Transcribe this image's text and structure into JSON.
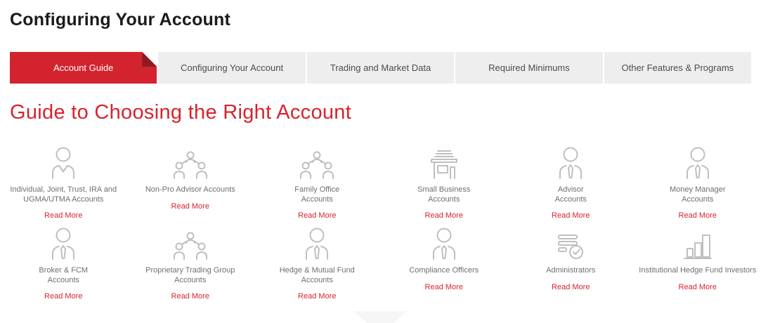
{
  "header": {
    "title": "Configuring Your Account"
  },
  "tabs": [
    {
      "label": "Account Guide",
      "active": true
    },
    {
      "label": "Configuring Your Account",
      "active": false
    },
    {
      "label": "Trading and Market Data",
      "active": false
    },
    {
      "label": "Required Minimums",
      "active": false
    },
    {
      "label": "Other Features & Programs",
      "active": false
    }
  ],
  "section": {
    "heading": "Guide to Choosing the Right Account",
    "read_more_label": "Read More"
  },
  "cards": [
    {
      "line1": "Individual, Joint, Trust, IRA and",
      "line2": "UGMA/UTMA Accounts",
      "icon": "person-icon"
    },
    {
      "line1": "Non-Pro Advisor Accounts",
      "line2": "",
      "icon": "people-group-icon"
    },
    {
      "line1": "Family Office",
      "line2": "Accounts",
      "icon": "people-group-icon"
    },
    {
      "line1": "Small Business",
      "line2": "Accounts",
      "icon": "storefront-icon"
    },
    {
      "line1": "Advisor",
      "line2": "Accounts",
      "icon": "person-tie-icon"
    },
    {
      "line1": "Money Manager",
      "line2": "Accounts",
      "icon": "person-tie-icon"
    },
    {
      "line1": "Broker & FCM",
      "line2": "Accounts",
      "icon": "person-tie-icon"
    },
    {
      "line1": "Proprietary Trading Group",
      "line2": "Accounts",
      "icon": "people-group-icon"
    },
    {
      "line1": "Hedge & Mutual Fund",
      "line2": "Accounts",
      "icon": "person-tie-icon"
    },
    {
      "line1": "Compliance Officers",
      "line2": "",
      "icon": "person-tie-icon"
    },
    {
      "line1": "Administrators",
      "line2": "",
      "icon": "checklist-icon"
    },
    {
      "line1": "Institutional Hedge Fund Investors",
      "line2": "",
      "icon": "bar-chart-icon"
    }
  ],
  "colors": {
    "accent_red": "#d2232e",
    "fold_red": "#8f1b22",
    "tab_bg": "#eeeeee",
    "icon_gray": "#bfbfbf",
    "label_gray": "#6f6f6f",
    "scroll_indicator_gray": "#f6f6f6"
  }
}
